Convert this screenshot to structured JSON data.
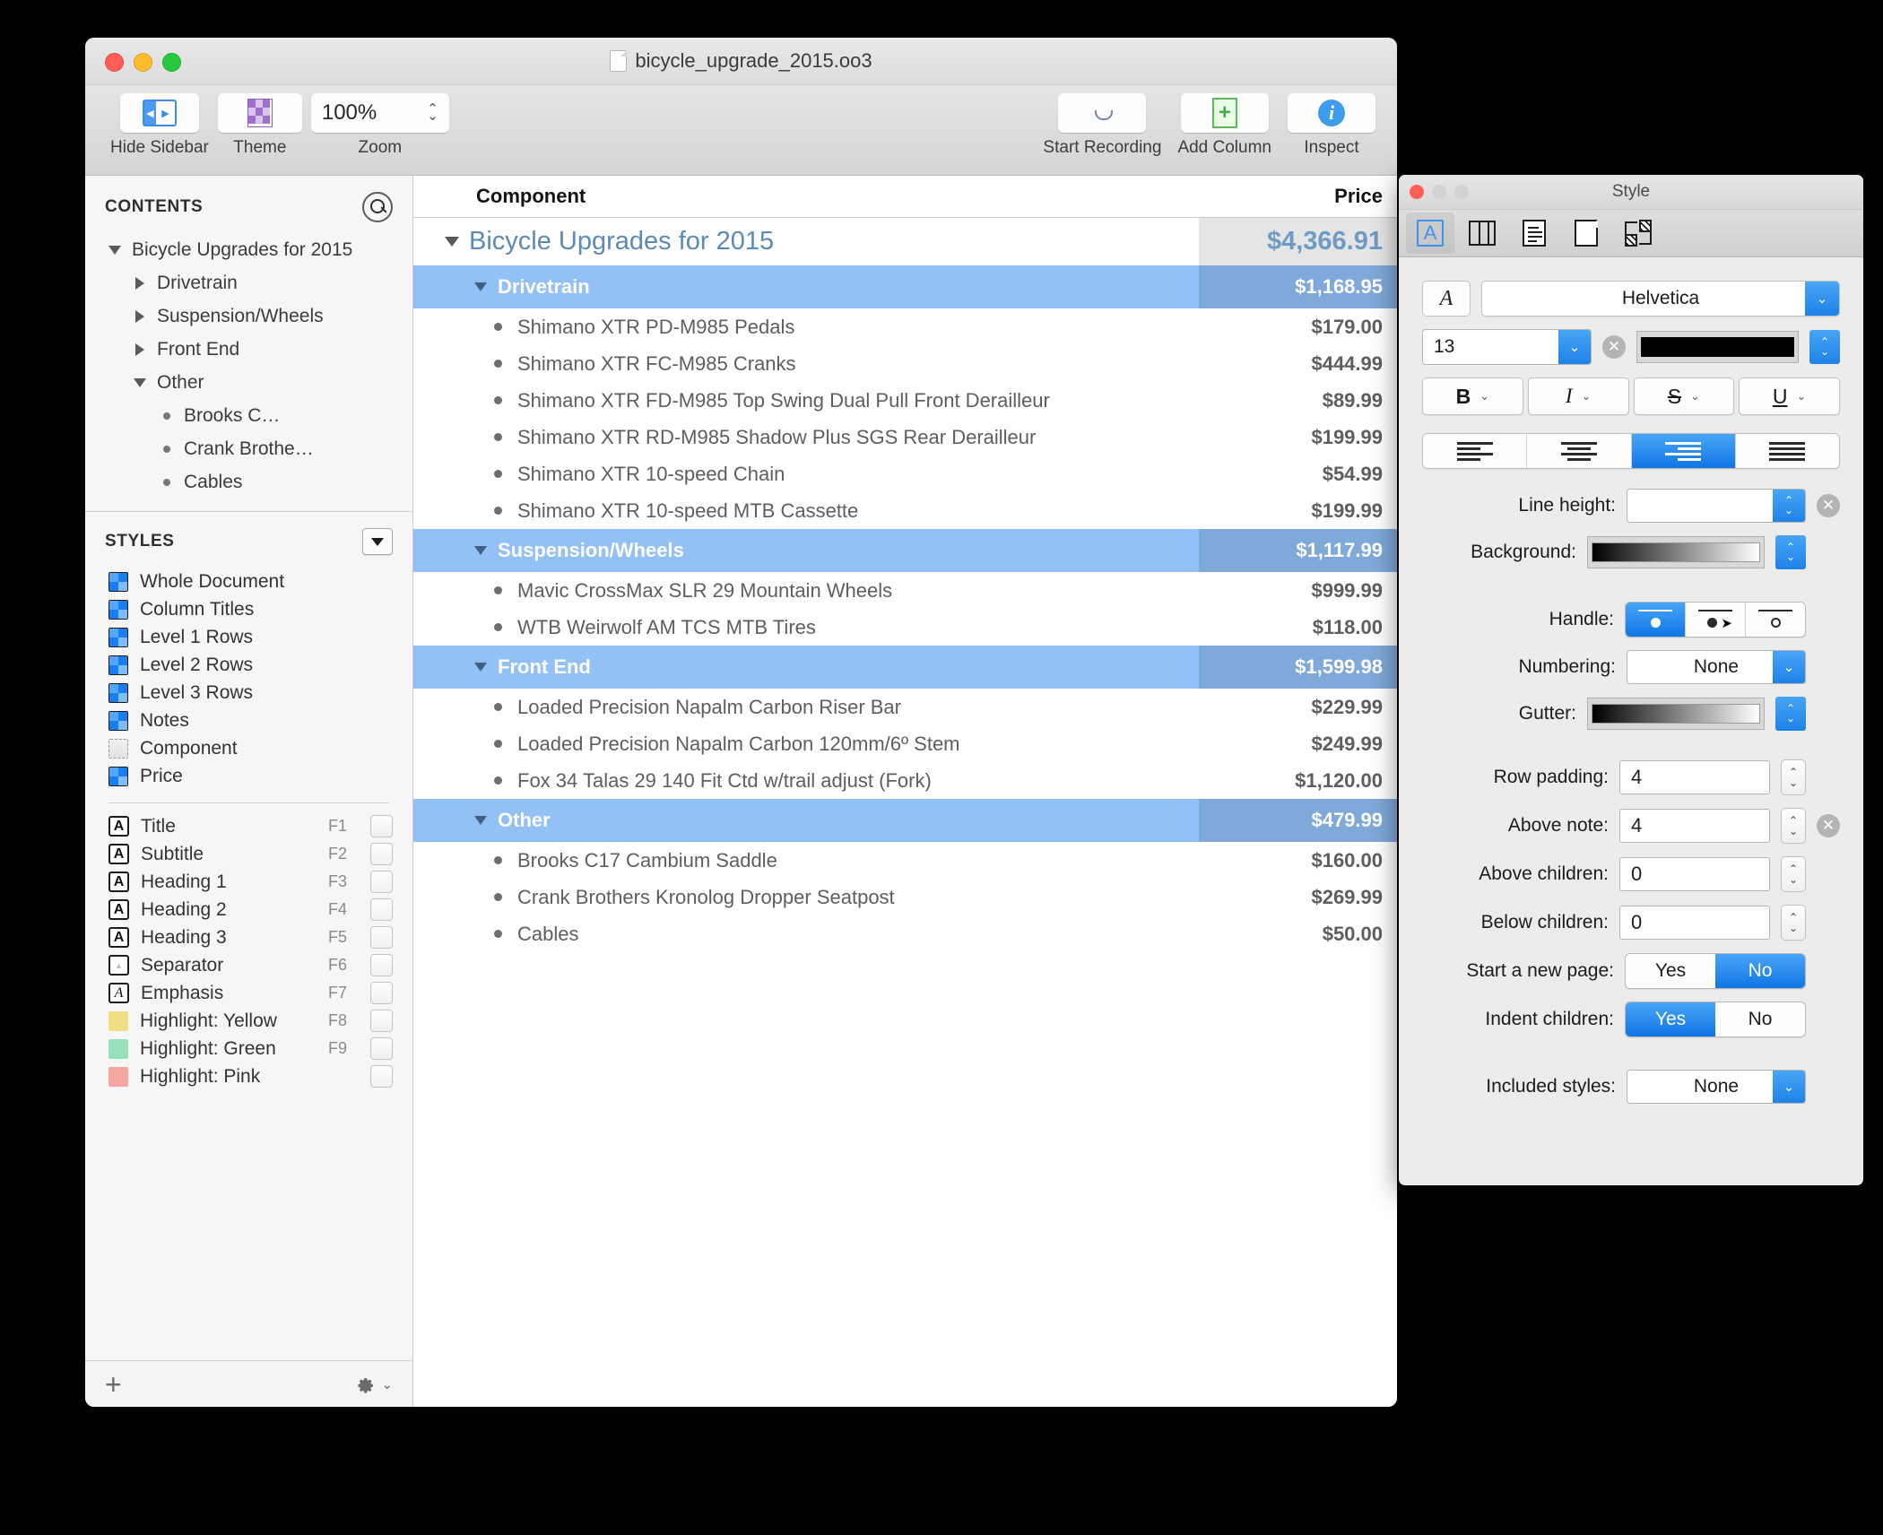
{
  "window": {
    "title": "bicycle_upgrade_2015.oo3",
    "toolbar": {
      "hide_sidebar_label": "Hide Sidebar",
      "theme_label": "Theme",
      "zoom_label": "Zoom",
      "zoom_value": "100%",
      "start_recording_label": "Start Recording",
      "add_column_label": "Add Column",
      "inspect_label": "Inspect"
    }
  },
  "sidebar": {
    "contents_title": "CONTENTS",
    "outline": [
      {
        "label": "Bicycle Upgrades for 2015",
        "level": 0,
        "marker": "tri-down"
      },
      {
        "label": "Drivetrain",
        "level": 1,
        "marker": "tri-right"
      },
      {
        "label": "Suspension/Wheels",
        "level": 1,
        "marker": "tri-right"
      },
      {
        "label": "Front End",
        "level": 1,
        "marker": "tri-right"
      },
      {
        "label": "Other",
        "level": 1,
        "marker": "tri-down"
      },
      {
        "label": "Brooks C…",
        "level": 2,
        "marker": "dot"
      },
      {
        "label": "Crank Brothe…",
        "level": 2,
        "marker": "dot"
      },
      {
        "label": "Cables",
        "level": 2,
        "marker": "dot"
      }
    ],
    "styles_title": "STYLES",
    "styles": [
      {
        "label": "Whole Document",
        "swatch": "blue-quad"
      },
      {
        "label": "Column Titles",
        "swatch": "blue-quad"
      },
      {
        "label": "Level 1 Rows",
        "swatch": "blue-quad"
      },
      {
        "label": "Level 2 Rows",
        "swatch": "blue-quad"
      },
      {
        "label": "Level 3 Rows",
        "swatch": "blue-quad"
      },
      {
        "label": "Notes",
        "swatch": "blue-quad"
      },
      {
        "label": "Component",
        "swatch": "dashed"
      },
      {
        "label": "Price",
        "swatch": "blue-quad"
      }
    ],
    "named_styles": [
      {
        "label": "Title",
        "key": "F1",
        "icon": "A",
        "color": null
      },
      {
        "label": "Subtitle",
        "key": "F2",
        "icon": "A",
        "color": null
      },
      {
        "label": "Heading 1",
        "key": "F3",
        "icon": "A",
        "color": null
      },
      {
        "label": "Heading 2",
        "key": "F4",
        "icon": "A",
        "color": null
      },
      {
        "label": "Heading 3",
        "key": "F5",
        "icon": "A",
        "color": null
      },
      {
        "label": "Separator",
        "key": "F6",
        "icon": "sep",
        "color": null
      },
      {
        "label": "Emphasis",
        "key": "F7",
        "icon": "A-italic",
        "color": null
      },
      {
        "label": "Highlight: Yellow",
        "key": "F8",
        "icon": "color",
        "color": "#efdf82"
      },
      {
        "label": "Highlight: Green",
        "key": "F9",
        "icon": "color",
        "color": "#97e0bc"
      },
      {
        "label": "Highlight: Pink",
        "key": "",
        "icon": "color",
        "color": "#f4a6a1"
      }
    ],
    "footer": {
      "add_label": "+",
      "gear_label": "⚙"
    }
  },
  "outline_table": {
    "columns": [
      "Component",
      "Price"
    ],
    "rows": [
      {
        "kind": "root",
        "component": "Bicycle Upgrades for 2015",
        "price": "$4,366.91"
      },
      {
        "kind": "section",
        "component": "Drivetrain",
        "price": "$1,168.95"
      },
      {
        "kind": "leaf",
        "component": "Shimano XTR PD-M985 Pedals",
        "price": "$179.00"
      },
      {
        "kind": "leaf",
        "component": "Shimano XTR FC-M985 Cranks",
        "price": "$444.99"
      },
      {
        "kind": "leaf",
        "component": "Shimano XTR FD-M985 Top Swing Dual Pull Front Derailleur",
        "price": "$89.99"
      },
      {
        "kind": "leaf",
        "component": "Shimano XTR RD-M985 Shadow Plus SGS Rear Derailleur",
        "price": "$199.99"
      },
      {
        "kind": "leaf",
        "component": "Shimano XTR 10-speed Chain",
        "price": "$54.99"
      },
      {
        "kind": "leaf",
        "component": "Shimano XTR 10-speed MTB Cassette",
        "price": "$199.99"
      },
      {
        "kind": "section",
        "component": "Suspension/Wheels",
        "price": "$1,117.99"
      },
      {
        "kind": "leaf",
        "component": "Mavic CrossMax SLR 29 Mountain Wheels",
        "price": "$999.99"
      },
      {
        "kind": "leaf",
        "component": "WTB Weirwolf AM TCS MTB Tires",
        "price": "$118.00"
      },
      {
        "kind": "section",
        "component": "Front End",
        "price": "$1,599.98"
      },
      {
        "kind": "leaf",
        "component": "Loaded Precision Napalm Carbon Riser Bar",
        "price": "$229.99"
      },
      {
        "kind": "leaf",
        "component": "Loaded Precision Napalm Carbon 120mm/6º Stem",
        "price": "$249.99"
      },
      {
        "kind": "leaf",
        "component": "Fox 34 Talas 29 140 Fit Ctd w/trail adjust (Fork)",
        "price": "$1,120.00"
      },
      {
        "kind": "section",
        "component": "Other",
        "price": "$479.99"
      },
      {
        "kind": "leaf",
        "component": "Brooks C17 Cambium Saddle",
        "price": "$160.00"
      },
      {
        "kind": "leaf",
        "component": "Crank Brothers Kronolog Dropper Seatpost",
        "price": "$269.99"
      },
      {
        "kind": "leaf",
        "component": "Cables",
        "price": "$50.00"
      }
    ]
  },
  "inspector": {
    "title": "Style",
    "tabs": [
      "text-tab",
      "columns-tab",
      "document-tab",
      "page-tab",
      "theme-tab"
    ],
    "font_family": "Helvetica",
    "font_size": "13",
    "bold_label": "B",
    "italic_label": "I",
    "strike_label": "S",
    "underline_label": "U",
    "alignment_selected": "right",
    "line_height_label": "Line height:",
    "line_height_value": "",
    "background_label": "Background:",
    "handle_label": "Handle:",
    "handle_selected": "filled-dot",
    "numbering_label": "Numbering:",
    "numbering_value": "None",
    "gutter_label": "Gutter:",
    "row_padding_label": "Row padding:",
    "row_padding_value": "4",
    "above_note_label": "Above note:",
    "above_note_value": "4",
    "above_children_label": "Above children:",
    "above_children_value": "0",
    "below_children_label": "Below children:",
    "below_children_value": "0",
    "start_new_page_label": "Start a new page:",
    "start_new_page_yes": "Yes",
    "start_new_page_no": "No",
    "start_new_page_selected": "No",
    "indent_children_label": "Indent children:",
    "indent_children_yes": "Yes",
    "indent_children_no": "No",
    "indent_children_selected": "Yes",
    "included_styles_label": "Included styles:",
    "included_styles_value": "None"
  },
  "colors": {
    "section_row": "#93c0f5",
    "section_price": "#7fa9d9",
    "root_price_bg": "#e5e5e5",
    "root_text": "#5b8bb5",
    "accent_blue": "#1e82e8"
  }
}
